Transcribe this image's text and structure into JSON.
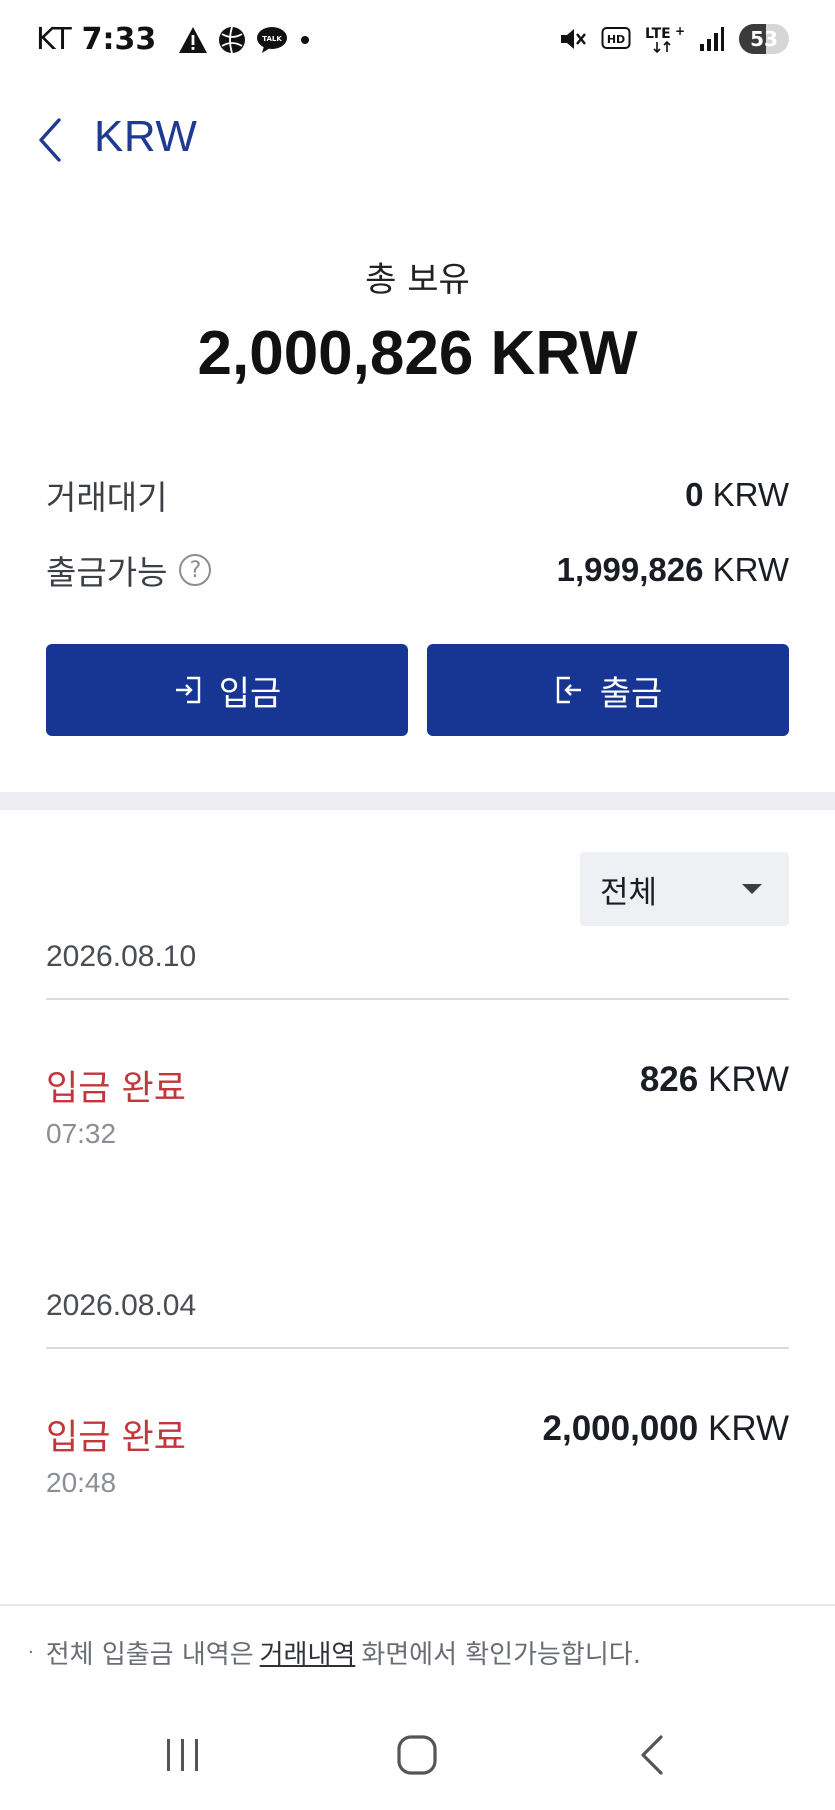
{
  "status_bar": {
    "carrier": "KT",
    "time": "7:33",
    "battery_level": "53",
    "network": "LTE+"
  },
  "header": {
    "title": "KRW"
  },
  "summary": {
    "total_label": "총 보유",
    "total_value": "2,000,826 KRW",
    "pending_label": "거래대기",
    "pending_amount": "0",
    "pending_unit": " KRW",
    "withdrawable_label": "출금가능",
    "withdrawable_amount": "1,999,826",
    "withdrawable_unit": " KRW"
  },
  "actions": {
    "deposit_label": "입금",
    "withdraw_label": "출금"
  },
  "filter": {
    "selected": "전체"
  },
  "transactions": [
    {
      "date": "2026.08.10",
      "status": "입금 완료",
      "time": "07:32",
      "amount": "826",
      "unit": " KRW"
    },
    {
      "date": "2026.08.04",
      "status": "입금 완료",
      "time": "20:48",
      "amount": "2,000,000",
      "unit": " KRW"
    }
  ],
  "footer": {
    "bullet": "·",
    "note_prefix": "전체 입출금 내역은",
    "note_link": "거래내역",
    "note_suffix": "화면에서 확인가능합니다."
  },
  "colors": {
    "primary": "#173592",
    "accent_red": "#c0373c",
    "title_blue": "#1f3a93"
  }
}
